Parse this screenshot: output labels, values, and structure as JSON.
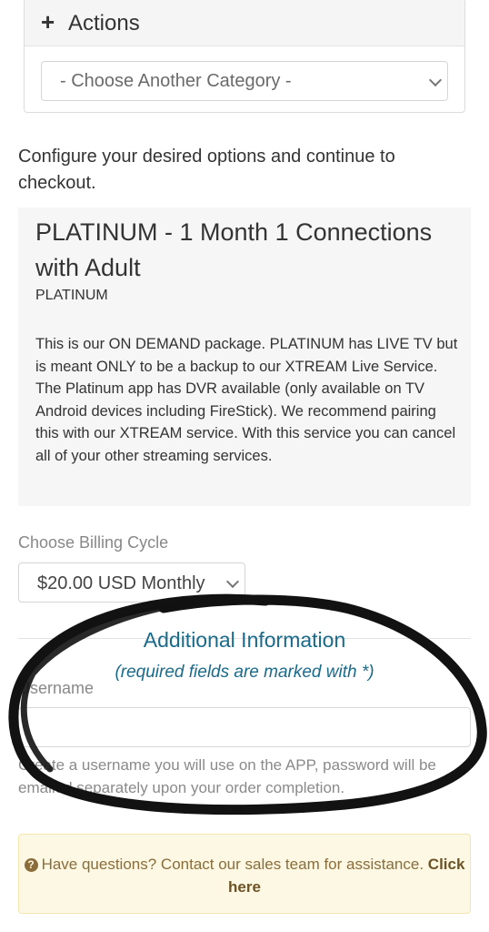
{
  "actions_panel": {
    "title": "Actions",
    "category_select": {
      "value": "- Choose Another Category -"
    }
  },
  "intro": "Configure your desired options and continue to checkout.",
  "product": {
    "title": "PLATINUM - 1 Month 1 Connections with Adult",
    "subtitle": "PLATINUM",
    "description": "This is our ON DEMAND package. PLATINUM has LIVE TV but is meant ONLY to be a backup to our XTREAM Live Service. The Platinum app has DVR available (only available on TV Android devices including FireStick). We recommend pairing this with our XTREAM service. With this service you can cancel all of your other streaming services."
  },
  "billing": {
    "label": "Choose Billing Cycle",
    "value": "$20.00 USD Monthly"
  },
  "additional_info": {
    "title": "Additional Information",
    "note": "(required fields are marked with *)",
    "username_label": "Username",
    "username_value": "",
    "username_help": "Create a username you will use on the APP, password will be emailed separately upon your order completion."
  },
  "help_box": {
    "text": "Have questions? Contact our sales team for assistance.",
    "link_text": "Click here"
  },
  "colors": {
    "accent": "#1a6a8a",
    "warning_bg": "#fcf8e3",
    "warning_text": "#8a6d3b",
    "panel_bg": "#f6f6f6"
  },
  "icons": [
    "plus-icon",
    "chevron-down-icon",
    "question-circle-icon"
  ]
}
